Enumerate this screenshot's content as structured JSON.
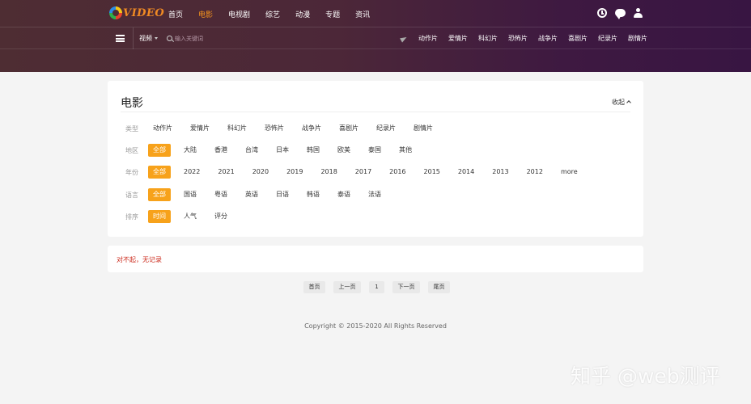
{
  "brand": {
    "logo_text": "VIDEO"
  },
  "topnav": {
    "items": [
      "首页",
      "电影",
      "电视剧",
      "综艺",
      "动漫",
      "专题",
      "资讯"
    ],
    "active_index": 1
  },
  "header_icons": [
    "clock-icon",
    "chat-icon",
    "user-icon"
  ],
  "searchbar": {
    "type_label": "视频",
    "placeholder": "输入关键词"
  },
  "subnav": {
    "items": [
      "动作片",
      "爱情片",
      "科幻片",
      "恐怖片",
      "战争片",
      "喜剧片",
      "纪录片",
      "剧情片"
    ]
  },
  "filter_card": {
    "title": "电影",
    "collapse_label": "收起",
    "rows": [
      {
        "label": "类型",
        "options": [
          "动作片",
          "爱情片",
          "科幻片",
          "恐怖片",
          "战争片",
          "喜剧片",
          "纪录片",
          "剧情片"
        ],
        "active_index": -1
      },
      {
        "label": "地区",
        "options": [
          "全部",
          "大陆",
          "香港",
          "台湾",
          "日本",
          "韩国",
          "欧美",
          "泰国",
          "其他"
        ],
        "active_index": 0
      },
      {
        "label": "年份",
        "options": [
          "全部",
          "2022",
          "2021",
          "2020",
          "2019",
          "2018",
          "2017",
          "2016",
          "2015",
          "2014",
          "2013",
          "2012",
          "more"
        ],
        "active_index": 0
      },
      {
        "label": "语言",
        "options": [
          "全部",
          "国语",
          "粤语",
          "英语",
          "日语",
          "韩语",
          "泰语",
          "法语"
        ],
        "active_index": 0
      },
      {
        "label": "排序",
        "options": [
          "时间",
          "人气",
          "评分"
        ],
        "active_index": 0
      }
    ]
  },
  "empty_notice": "对不起，无记录",
  "pagination": {
    "first": "首页",
    "prev": "上一页",
    "current": "1",
    "next": "下一页",
    "last": "尾页"
  },
  "footer": {
    "copyright": "Copyright © 2015-2020 All Rights Reserved"
  },
  "watermark": "知乎 @web测评",
  "colors": {
    "accent": "#f7a21b",
    "active_nav": "#f7941d",
    "notice_text": "#cc2b1d",
    "header_gradient_start": "#4e2d33",
    "header_gradient_end": "#381542"
  }
}
